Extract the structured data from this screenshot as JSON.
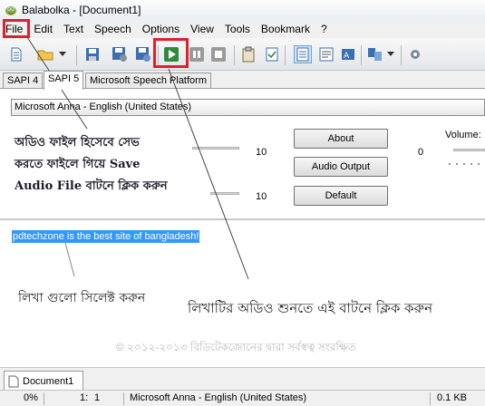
{
  "window": {
    "title": "Balabolka - [Document1]"
  },
  "menu": [
    "File",
    "Edit",
    "Text",
    "Speech",
    "Options",
    "View",
    "Tools",
    "Bookmark",
    "?"
  ],
  "engine_tabs": [
    "SAPI 4",
    "SAPI 5",
    "Microsoft Speech Platform"
  ],
  "voice": {
    "selected": "Microsoft Anna - English (United States)"
  },
  "settings": {
    "rate_value": "10",
    "pitch_value": "10",
    "volume_value": "0",
    "volume_label": "Volume:",
    "about_label": "About",
    "audio_output_label": "Audio Output",
    "default_label": "Default"
  },
  "annotations": {
    "save_line1": "অডিও ফাইল হিসেবে সেভ",
    "save_line2": "করতে ফাইলে গিয়ে Save",
    "save_line3": "Audio File বাটনে ক্লিক করুন",
    "select_text": "লিখা গুলো সিলেক্ট করুন",
    "play_text": "লিখাটির অডিও শুনতে এই বাটনে ক্লিক করুন"
  },
  "editor": {
    "selected_text": "pdtechzone is the best site of bangladesh!",
    "copyright": "© ২০১২-২০১৩ বিডিটেকজোনের দ্বারা সর্বস্বত্ব সংরক্ষিত"
  },
  "documents": [
    "Document1"
  ],
  "status": {
    "progress": "0%",
    "line": "1:",
    "col": "1",
    "voice": "Microsoft Anna - English (United States)",
    "size": "0.1 KB"
  },
  "highlight_color": "#e0202a",
  "selection_color": "#3399ff"
}
